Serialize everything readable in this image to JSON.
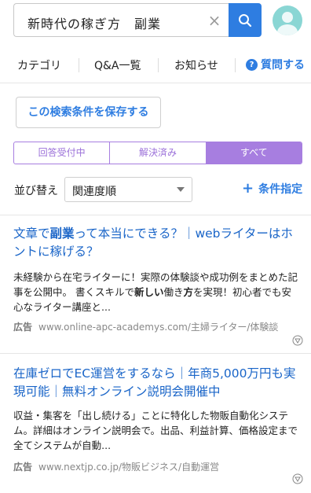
{
  "search": {
    "query": "新時代の稼ぎ方　副業",
    "clear_symbol": "×"
  },
  "nav": {
    "items": [
      "カテゴリ",
      "Q&A一覧",
      "お知らせ"
    ],
    "ask_label": "質問する",
    "ask_icon": "?"
  },
  "save_button_label": "この検索条件を保存する",
  "tabs": [
    {
      "label": "回答受付中",
      "active": false
    },
    {
      "label": "解決済み",
      "active": false
    },
    {
      "label": "すべて",
      "active": true
    }
  ],
  "sort": {
    "label": "並び替え",
    "selected": "関連度順",
    "filter_label": "条件指定",
    "filter_icon": "+"
  },
  "ads": [
    {
      "title_parts": [
        "文章で",
        "副業",
        "って本当にできる？｜webライターはホントに稼げる？"
      ],
      "desc_parts": [
        "未経験から在宅ライターに！実際の体験談や成功例をまとめた記事を公開中。 書くスキルで",
        "新しい",
        "働き",
        "方",
        "を実現！初心者でも安心なライター講座と..."
      ],
      "tag": "広告",
      "url": "www.online-apc-academys.com/主婦ライター/体験談"
    },
    {
      "title_parts": [
        "在庫ゼロでEC運営をするなら｜年商5,000万円も実現可能｜無料オンライン説明会開催中"
      ],
      "desc_parts": [
        "収益・集客を「出し続ける」ことに特化した物販自動化システム。詳細はオンライン説明会で。出品、利益計算、価格設定まで全てシステムが自動..."
      ],
      "tag": "広告",
      "url": "www.nextjp.co.jp/物販ビジネス/自動運営"
    }
  ],
  "colors": {
    "accent_blue": "#2e7de1",
    "tab_purple": "#a77ee0",
    "link_blue": "#1a65c8",
    "avatar_teal": "#8ad6d4"
  }
}
